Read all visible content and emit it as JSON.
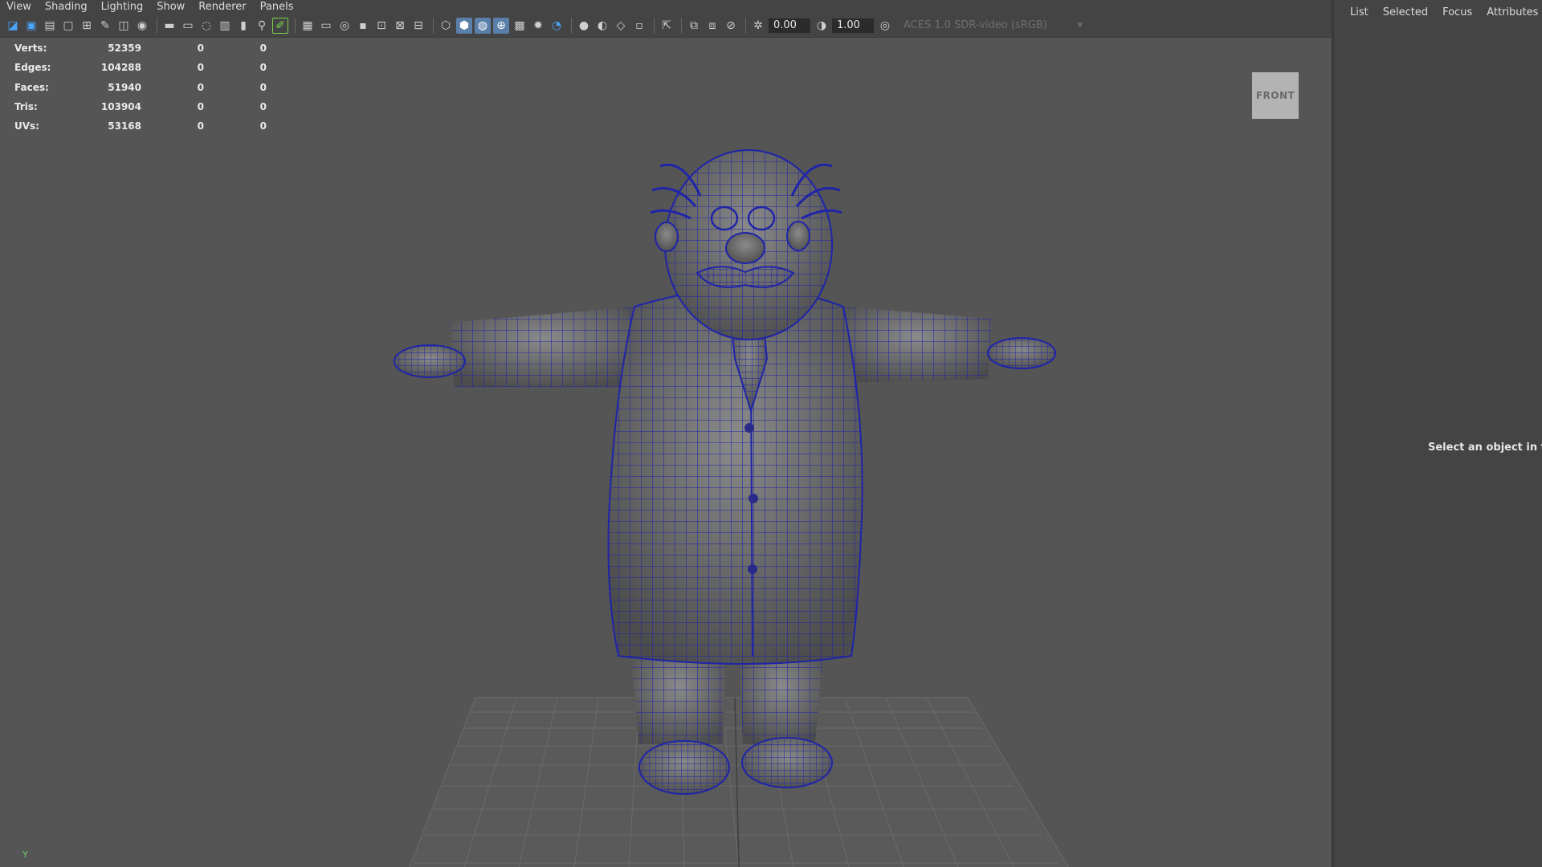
{
  "menu": [
    "View",
    "Shading",
    "Lighting",
    "Show",
    "Renderer",
    "Panels"
  ],
  "toolbar": {
    "exposure_value": "0.00",
    "gamma_value": "1.00",
    "color_space": "ACES 1.0 SDR-video (sRGB)"
  },
  "hud": {
    "rows": [
      {
        "label": "Verts:",
        "values": [
          "52359",
          "0",
          "0"
        ]
      },
      {
        "label": "Edges:",
        "values": [
          "104288",
          "0",
          "0"
        ]
      },
      {
        "label": "Faces:",
        "values": [
          "51940",
          "0",
          "0"
        ]
      },
      {
        "label": "Tris:",
        "values": [
          "103904",
          "0",
          "0"
        ]
      },
      {
        "label": "UVs:",
        "values": [
          "53168",
          "0",
          "0"
        ]
      }
    ]
  },
  "viewcube_label": "FRONT",
  "axis_label": "Y",
  "right_panel": {
    "tabs": [
      "List",
      "Selected",
      "Focus",
      "Attributes"
    ],
    "hint": "Select an object in the s"
  },
  "colors": {
    "viewport_bg": "#555555",
    "panel_bg": "#444444",
    "wireframe": "#1f24a8",
    "accent": "#5a7fa8"
  }
}
